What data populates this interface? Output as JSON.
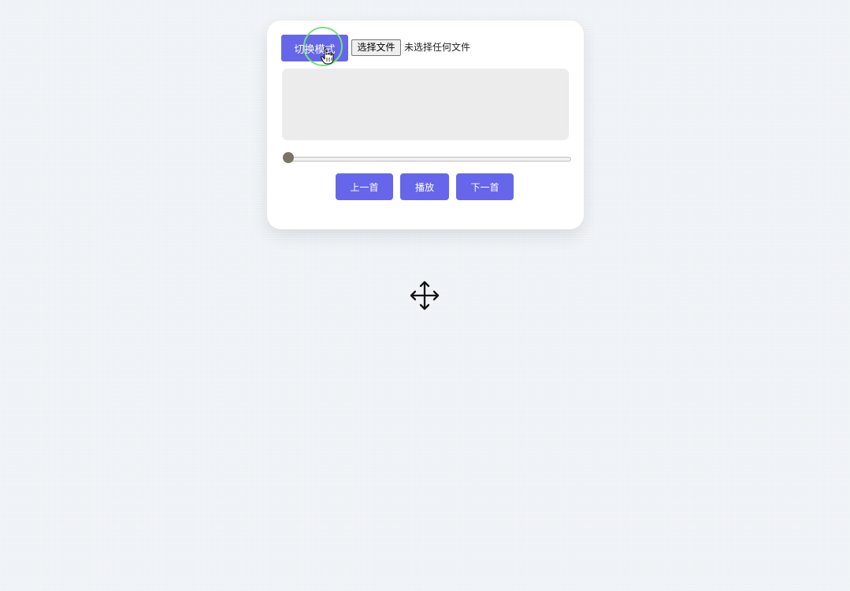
{
  "toolbar": {
    "mode_button_label": "切换模式",
    "file_button_label": "选择文件",
    "file_status": "未选择任何文件"
  },
  "playback": {
    "progress": 0
  },
  "controls": {
    "previous_label": "上一首",
    "play_label": "播放",
    "next_label": "下一首"
  },
  "icons": {
    "cursor": "hand-pointer-icon",
    "move": "move-icon"
  },
  "colors": {
    "accent": "#6666ea",
    "visualizer": "#ececec",
    "click_ring": "#74e27b",
    "slider_thumb": "#7b7466"
  }
}
